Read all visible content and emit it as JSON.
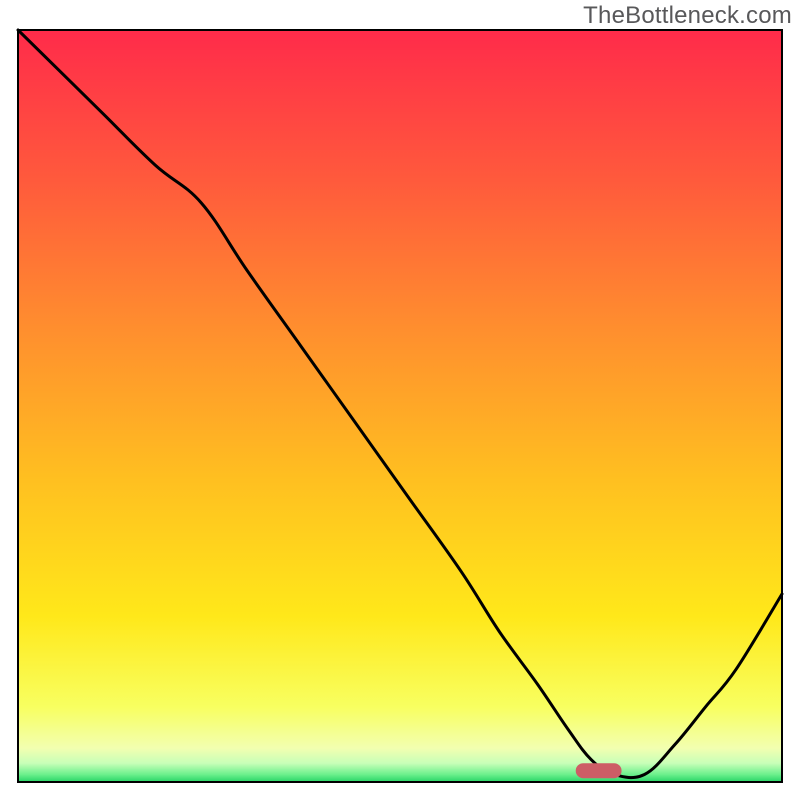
{
  "watermark": "TheBottleneck.com",
  "chart_data": {
    "type": "line",
    "title": "",
    "xlabel": "",
    "ylabel": "",
    "xlim": [
      0,
      100
    ],
    "ylim": [
      0,
      100
    ],
    "x": [
      0,
      5,
      11,
      18,
      24,
      30,
      37,
      44,
      51,
      58,
      63,
      68,
      72,
      75,
      78,
      82,
      86,
      90,
      94,
      100
    ],
    "y": [
      100,
      95,
      89,
      82,
      77,
      68,
      58,
      48,
      38,
      28,
      20,
      13,
      7,
      3,
      1,
      1,
      5,
      10,
      15,
      25
    ],
    "marker": {
      "x": 76,
      "y": 1.5,
      "w": 6,
      "h": 2
    },
    "gradient_stops": [
      {
        "offset": 0.0,
        "color": "#ff2b4a"
      },
      {
        "offset": 0.2,
        "color": "#ff5a3c"
      },
      {
        "offset": 0.4,
        "color": "#ff8f2e"
      },
      {
        "offset": 0.6,
        "color": "#ffc020"
      },
      {
        "offset": 0.78,
        "color": "#ffe81a"
      },
      {
        "offset": 0.9,
        "color": "#f8ff60"
      },
      {
        "offset": 0.955,
        "color": "#f2ffb0"
      },
      {
        "offset": 0.975,
        "color": "#c8ffb8"
      },
      {
        "offset": 0.99,
        "color": "#6cf08c"
      },
      {
        "offset": 1.0,
        "color": "#27d467"
      }
    ],
    "marker_color": "#cd5d66",
    "line_color": "#000000",
    "frame_color": "#000000"
  }
}
